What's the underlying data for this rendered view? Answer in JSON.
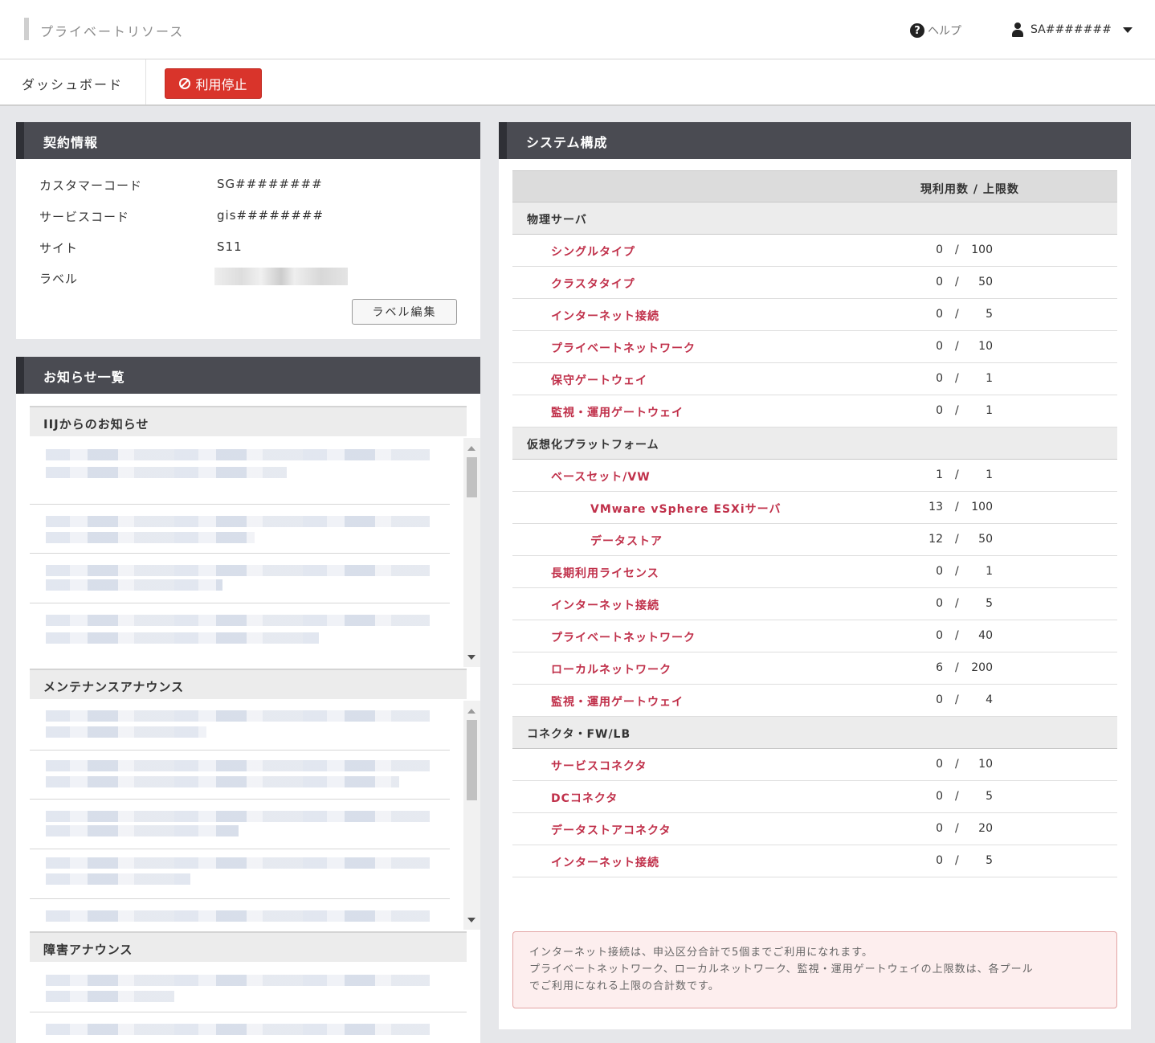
{
  "header": {
    "title": "プライベートリソース",
    "help_label": "ヘルプ",
    "user_name": "SA#######"
  },
  "tabs": {
    "dashboard_label": "ダッシュボード",
    "stop_label": "利用停止"
  },
  "contract": {
    "heading": "契約情報",
    "rows": [
      {
        "label": "カスタマーコード",
        "value": "SG########"
      },
      {
        "label": "サービスコード",
        "value": "gis########"
      },
      {
        "label": "サイト",
        "value": "S11"
      },
      {
        "label": "ラベル",
        "value": ""
      }
    ],
    "edit_label": "ラベル編集"
  },
  "notices": {
    "heading": "お知らせ一覧",
    "sections": [
      {
        "title": "IIJからのお知らせ"
      },
      {
        "title": "メンテナンスアナウンス"
      },
      {
        "title": "障害アナウンス"
      }
    ]
  },
  "system": {
    "heading": "システム構成",
    "column_header": "現利用数 / 上限数",
    "groups": [
      {
        "name": "物理サーバ",
        "rows": [
          {
            "label": "シングルタイプ",
            "current": "0",
            "max": "100",
            "level": 1
          },
          {
            "label": "クラスタタイプ",
            "current": "0",
            "max": "50",
            "level": 1
          },
          {
            "label": "インターネット接続",
            "current": "0",
            "max": "5",
            "level": 1
          },
          {
            "label": "プライベートネットワーク",
            "current": "0",
            "max": "10",
            "level": 1
          },
          {
            "label": "保守ゲートウェイ",
            "current": "0",
            "max": "1",
            "level": 1
          },
          {
            "label": "監視・運用ゲートウェイ",
            "current": "0",
            "max": "1",
            "level": 1
          }
        ]
      },
      {
        "name": "仮想化プラットフォーム",
        "rows": [
          {
            "label": "ベースセット/VW",
            "current": "1",
            "max": "1",
            "level": 1
          },
          {
            "label": "VMware vSphere ESXiサーバ",
            "current": "13",
            "max": "100",
            "level": 2
          },
          {
            "label": "データストア",
            "current": "12",
            "max": "50",
            "level": 2
          },
          {
            "label": "長期利用ライセンス",
            "current": "0",
            "max": "1",
            "level": 1
          },
          {
            "label": "インターネット接続",
            "current": "0",
            "max": "5",
            "level": 1
          },
          {
            "label": "プライベートネットワーク",
            "current": "0",
            "max": "40",
            "level": 1
          },
          {
            "label": "ローカルネットワーク",
            "current": "6",
            "max": "200",
            "level": 1
          },
          {
            "label": "監視・運用ゲートウェイ",
            "current": "0",
            "max": "4",
            "level": 1
          }
        ]
      },
      {
        "name": "コネクタ・FW/LB",
        "rows": [
          {
            "label": "サービスコネクタ",
            "current": "0",
            "max": "10",
            "level": 1
          },
          {
            "label": "DCコネクタ",
            "current": "0",
            "max": "5",
            "level": 1
          },
          {
            "label": "データストアコネクタ",
            "current": "0",
            "max": "20",
            "level": 1
          },
          {
            "label": "インターネット接続",
            "current": "0",
            "max": "5",
            "level": 1
          }
        ]
      }
    ],
    "note_lines": [
      "インターネット接続は、申込区分合計で5個までご利用になれます。",
      "プライベートネットワーク、ローカルネットワーク、監視・運用ゲートウェイの上限数は、各プール",
      "でご利用になれる上限の合計数です。"
    ]
  }
}
